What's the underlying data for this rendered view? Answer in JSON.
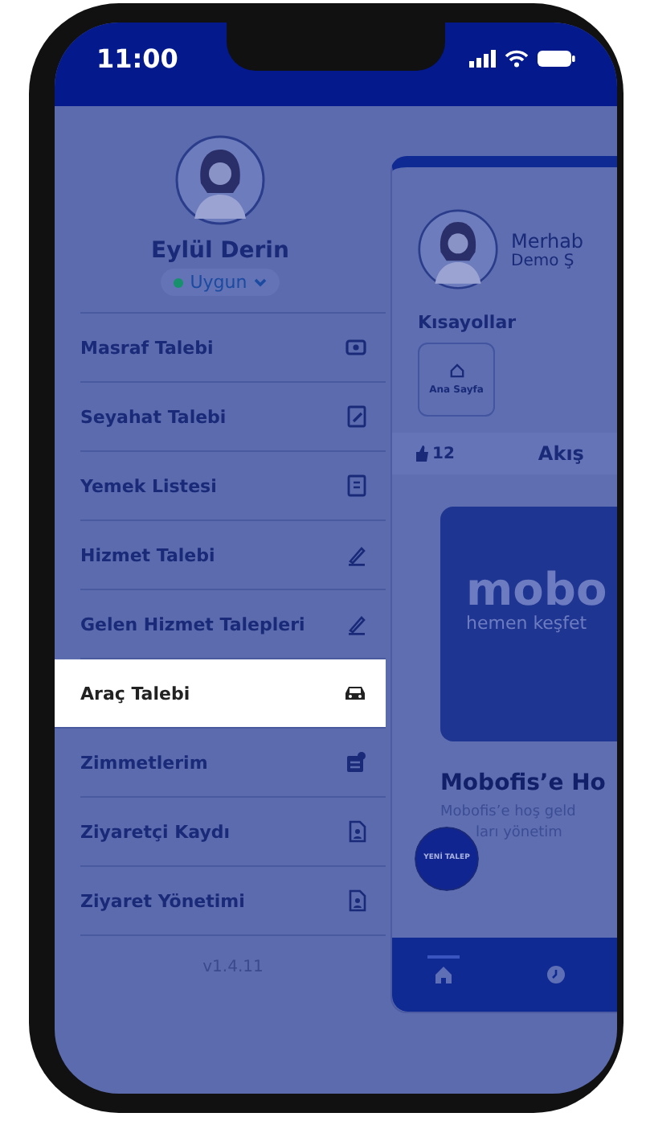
{
  "status_bar": {
    "time": "11:00"
  },
  "drawer": {
    "user": {
      "name": "Eylül Derin",
      "status": "Uygun"
    },
    "menu": [
      {
        "label": "Masraf Talebi",
        "kind": "money",
        "selected": false
      },
      {
        "label": "Seyahat Talebi",
        "kind": "edit-doc",
        "selected": false
      },
      {
        "label": "Yemek Listesi",
        "kind": "list-doc",
        "selected": false
      },
      {
        "label": "Hizmet Talebi",
        "kind": "pen",
        "selected": false
      },
      {
        "label": "Gelen Hizmet Talepleri",
        "kind": "pen",
        "selected": false
      },
      {
        "label": "Araç Talebi",
        "kind": "car",
        "selected": true
      },
      {
        "label": "Zimmetlerim",
        "kind": "box",
        "selected": false
      },
      {
        "label": "Ziyaretçi Kaydı",
        "kind": "person-doc",
        "selected": false
      },
      {
        "label": "Ziyaret Yönetimi",
        "kind": "person-doc",
        "selected": false
      }
    ],
    "version": "v1.4.11"
  },
  "home": {
    "greeting": "Merhab",
    "company": "Demo Ş",
    "shortcuts_title": "Kısayollar",
    "shortcuts": [
      {
        "label": "Ana Sayfa",
        "kind": "home"
      }
    ],
    "likes": "12",
    "feed_tab": "Akış",
    "banner": {
      "title": "mobo",
      "subtitle": "hemen keşfet"
    },
    "welcome_title": "Mobofis’e Ho",
    "welcome_text": [
      "Mobofis’e hoş geld",
      "ları yönetim"
    ],
    "fab": "YENİ TALEP",
    "bottom_nav": [
      {
        "kind": "home",
        "selected": true
      },
      {
        "kind": "clock",
        "selected": false
      }
    ]
  }
}
